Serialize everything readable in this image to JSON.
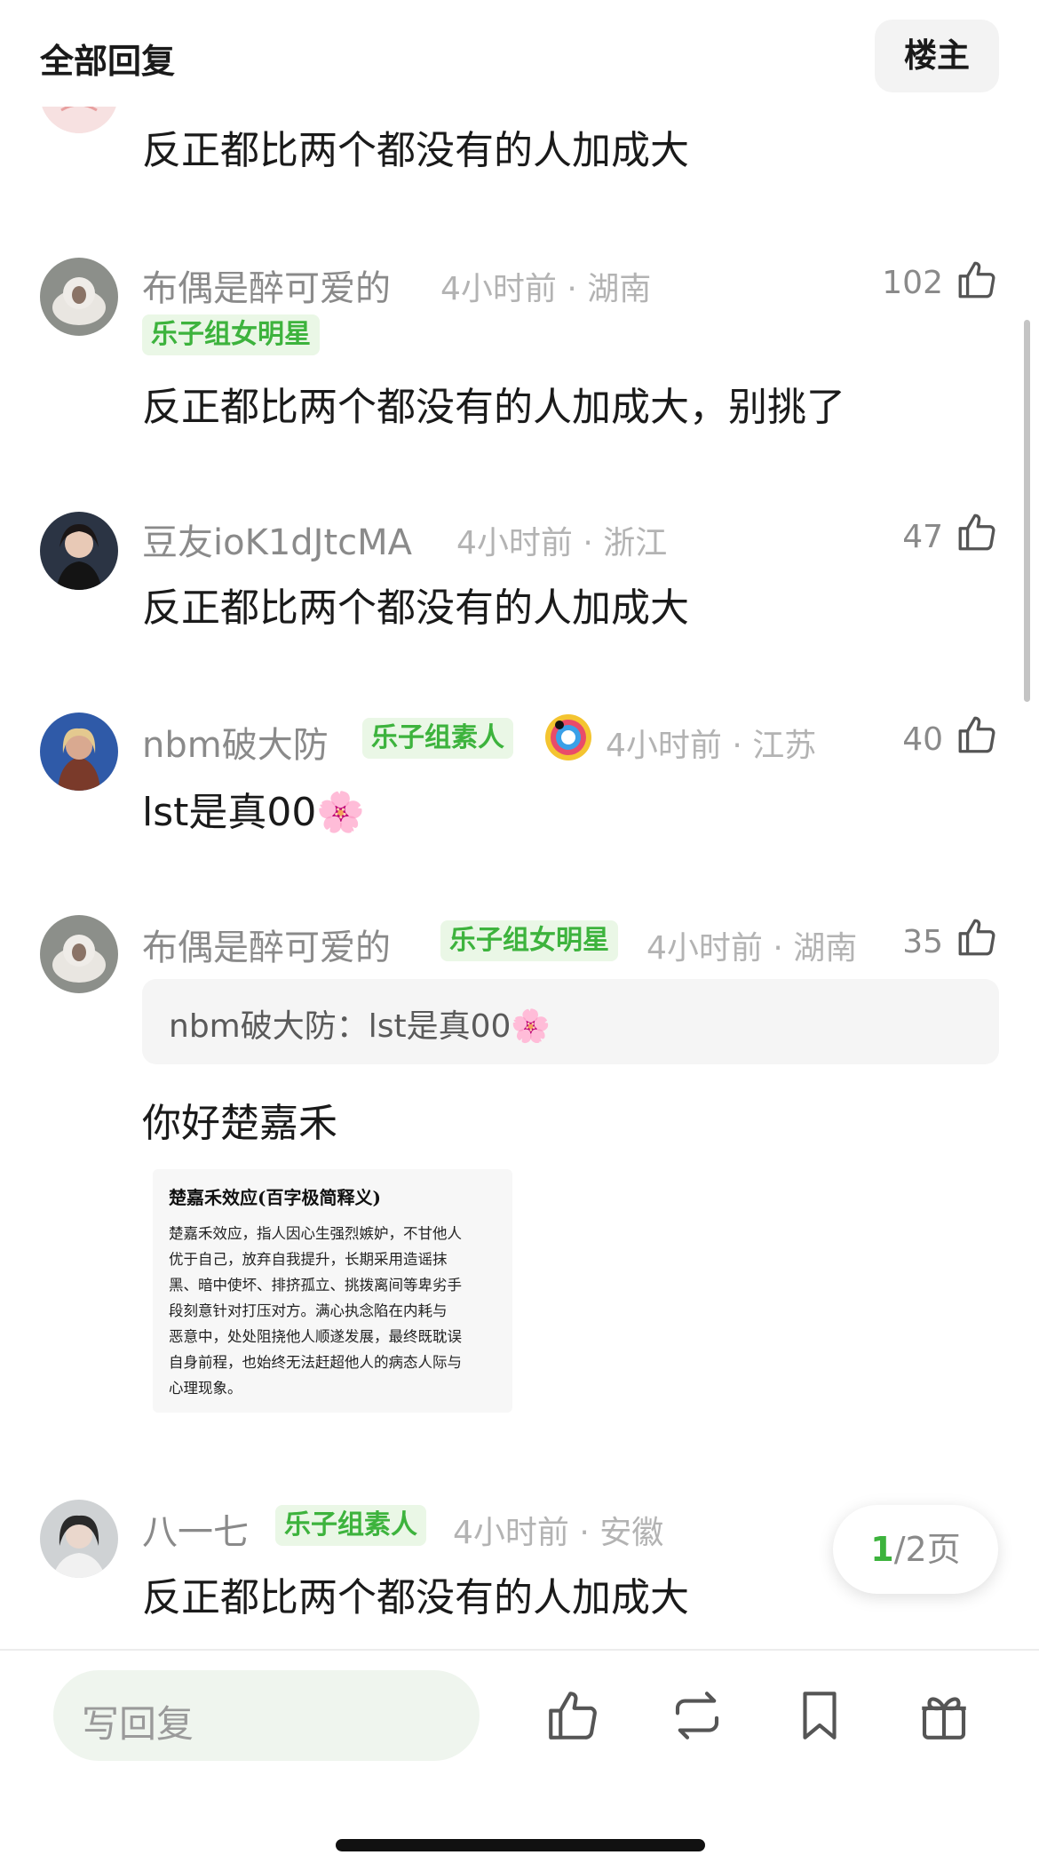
{
  "header": {
    "title": "全部回复",
    "owner_button": "楼主"
  },
  "comments": [
    {
      "text": "反正都比两个都没有的人加成大"
    },
    {
      "username": "布偶是醉可爱的",
      "time_location": "4小时前 · 湖南",
      "likes": "102",
      "badge": "乐子组女明星",
      "text": "反正都比两个都没有的人加成大，别挑了"
    },
    {
      "username": "豆友ioK1dJtcMA",
      "time_location": "4小时前 · 浙江",
      "likes": "47",
      "text": "反正都比两个都没有的人加成大"
    },
    {
      "username": "nbm破大防",
      "badge": "乐子组素人",
      "time_location": "4小时前 · 江苏",
      "likes": "40",
      "text": "lst是真00🌸"
    },
    {
      "username": "布偶是醉可爱的",
      "badge": "乐子组女明星",
      "time_location": "4小时前 · 湖南",
      "likes": "35",
      "quote": "nbm破大防：lst是真00🌸",
      "text": "你好楚嘉禾",
      "image": {
        "title": "楚嘉禾效应(百字极简释义)",
        "lines": [
          "楚嘉禾效应，指人因心生强烈嫉妒，不甘他人",
          "优于自己，放弃自我提升，长期采用造谣抹",
          "黑、暗中使坏、排挤孤立、挑拨离间等卑劣手",
          "段刻意针对打压对方。满心执念陷在内耗与",
          "恶意中，处处阻挠他人顺遂发展，最终既耽误",
          "自身前程，也始终无法赶超他人的病态人际与",
          "心理现象。"
        ]
      }
    },
    {
      "username": "八一七",
      "badge": "乐子组素人",
      "time_location": "4小时前 · 安徽",
      "text": "反正都比两个都没有的人加成大"
    }
  ],
  "pager": {
    "current": "1",
    "rest": "/2页"
  },
  "bottom_bar": {
    "reply_placeholder": "写回复"
  },
  "colors": {
    "accent_green": "#3db33d",
    "badge_bg": "#eaf7e6",
    "muted": "#8a8a8a"
  }
}
